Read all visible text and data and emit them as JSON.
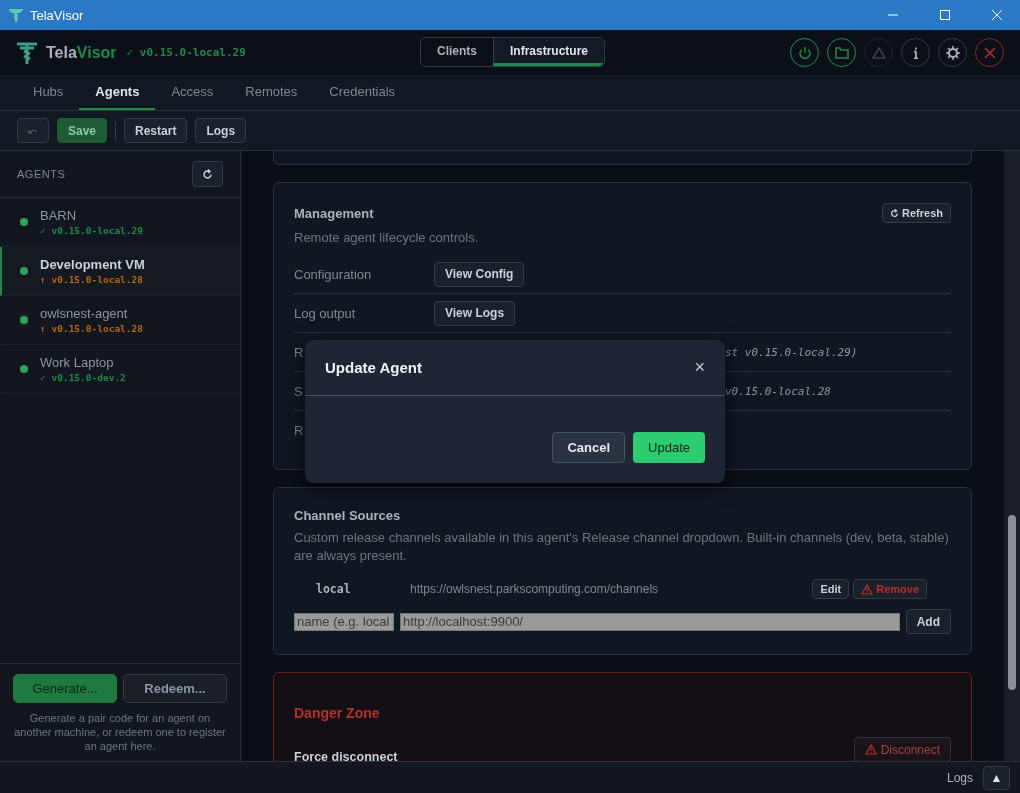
{
  "window": {
    "title": "TelaVisor"
  },
  "header": {
    "brand": {
      "part_1": "Tela",
      "part_2": "Visor"
    },
    "version": {
      "icon": "✓",
      "text": "v0.15.0-local.29"
    },
    "modes": [
      {
        "label": "Clients",
        "selected": false
      },
      {
        "label": "Infrastructure",
        "selected": true
      }
    ]
  },
  "tabs": [
    {
      "label": "Hubs",
      "selected": false
    },
    {
      "label": "Agents",
      "selected": true
    },
    {
      "label": "Access",
      "selected": false
    },
    {
      "label": "Remotes",
      "selected": false
    },
    {
      "label": "Credentials",
      "selected": false
    }
  ],
  "toolbar": {
    "save": {
      "label": "Save",
      "disabled": true
    },
    "buttons": [
      "Restart",
      "Logs"
    ]
  },
  "sidebar": {
    "heading": "AGENTS",
    "agents": [
      {
        "name": "BARN",
        "kind": "current",
        "icon": "✓",
        "version": "v0.15.0-local.29",
        "color": "#2ea55a",
        "selected": false
      },
      {
        "name": "Development VM",
        "kind": "outdated",
        "icon": "↑",
        "version": "v0.15.0-local.28",
        "color": "#2ea55a",
        "selected": true
      },
      {
        "name": "owlsnest-agent",
        "kind": "outdated",
        "icon": "↑",
        "version": "v0.15.0-local.28",
        "color": "#2ea55a",
        "selected": false
      },
      {
        "name": "Work Laptop",
        "kind": "current",
        "icon": "✓",
        "version": "v0.15.0-dev.2",
        "color": "#2ea55a",
        "selected": false
      }
    ],
    "generate": "Generate...",
    "redeem": "Redeem...",
    "hint": "Generate a pair code for an agent on another machine, or redeem one to register an agent here."
  },
  "management": {
    "title": "Management",
    "refresh": "Refresh",
    "description": "Remote agent lifecycle controls.",
    "rows": [
      {
        "kind": "button",
        "label": "Configuration",
        "button": "View Config"
      },
      {
        "kind": "button",
        "label": "Log output",
        "button": "View Logs"
      },
      {
        "kind": "text",
        "label": "R",
        "value": "st v0.15.0-local.29)"
      },
      {
        "kind": "text",
        "label": "S",
        "value": "v0.15.0-local.28"
      },
      {
        "kind": "text",
        "label": "R"
      }
    ]
  },
  "channels": {
    "title": "Channel Sources",
    "description": "Custom release channels available in this agent's Release channel dropdown. Built-in channels (dev, beta, stable) are always present.",
    "items": [
      {
        "name": "local",
        "url": "https://owlsnest.parkscomputing.com/channels",
        "edit": "Edit",
        "remove": "Remove"
      }
    ],
    "name_field": {
      "placeholder": "name (e.g. local"
    },
    "url_field": {
      "placeholder": "http://localhost:9900/"
    },
    "add": "Add"
  },
  "danger": {
    "title": "Danger Zone",
    "item": "Force disconnect",
    "button": {
      "label": "Disconnect",
      "disabled": true
    }
  },
  "dialog": {
    "title": "Update Agent",
    "close": "×",
    "cancel": "Cancel",
    "confirm": "Update"
  },
  "status_bar": {
    "logs": "Logs",
    "toggle": "▲"
  }
}
